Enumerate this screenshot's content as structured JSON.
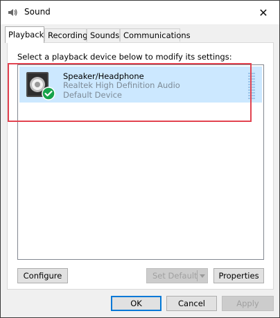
{
  "window": {
    "title": "Sound",
    "icon": "speaker-app-icon",
    "close_glyph": "✕"
  },
  "tabs": [
    {
      "label": "Playback",
      "active": true
    },
    {
      "label": "Recording",
      "active": false
    },
    {
      "label": "Sounds",
      "active": false
    },
    {
      "label": "Communications",
      "active": false
    }
  ],
  "playback": {
    "instruction": "Select a playback device below to modify its settings:",
    "devices": [
      {
        "name": "Speaker/Headphone",
        "driver": "Realtek High Definition Audio",
        "status": "Default Device",
        "icon": "speaker-icon",
        "badge": "green-check-icon",
        "selected": true,
        "highlighted": true
      }
    ]
  },
  "panel_buttons": {
    "configure": "Configure",
    "set_default": "Set Default",
    "set_default_enabled": false,
    "properties": "Properties"
  },
  "dialog_buttons": {
    "ok": "OK",
    "cancel": "Cancel",
    "apply": "Apply",
    "apply_enabled": false
  },
  "colors": {
    "selection": "#cce8ff",
    "highlight_box": "#e2424f",
    "accent": "#0078d7",
    "check_badge": "#16a34a"
  }
}
